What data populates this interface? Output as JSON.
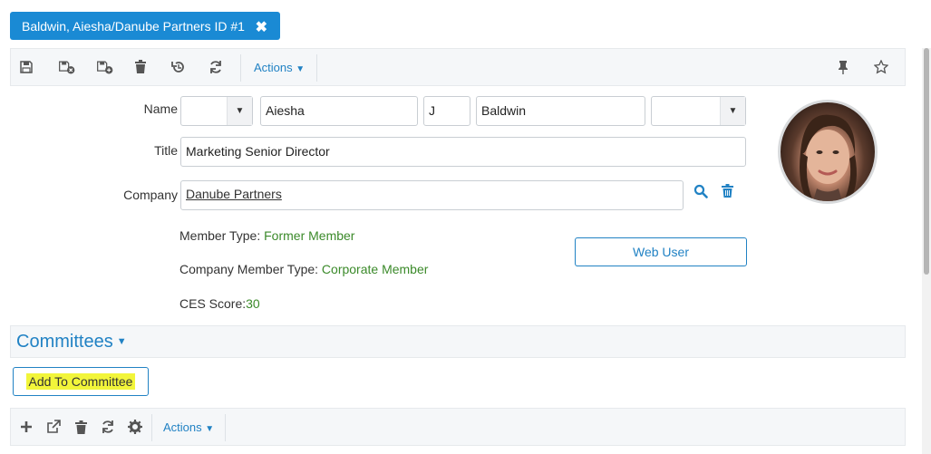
{
  "tab": {
    "title": "Baldwin, Aiesha/Danube Partners ID #1",
    "close_glyph": "✖"
  },
  "toolbar": {
    "icons": [
      "save-icon",
      "save-close-icon",
      "save-new-icon",
      "delete-icon",
      "undo-icon",
      "refresh-icon"
    ],
    "actions_label": "Actions",
    "right_icons": [
      "pin-icon",
      "star-icon"
    ]
  },
  "form": {
    "name_label": "Name",
    "prefix": "",
    "first_name": "Aiesha",
    "middle_initial": "J",
    "last_name": "Baldwin",
    "suffix": "",
    "title_label": "Title",
    "title_value": "Marketing Senior Director",
    "company_label": "Company",
    "company_value": "Danube Partners"
  },
  "info": {
    "member_type_label": "Member Type: ",
    "member_type_value": "Former Member",
    "company_member_type_label": "Company Member Type: ",
    "company_member_type_value": "Corporate Member",
    "ces_label": "CES Score:",
    "ces_value": "30"
  },
  "web_user_button": "Web User",
  "committees": {
    "title": "Committees",
    "add_button": "Add To Committee",
    "actions_label": "Actions"
  },
  "colors": {
    "accent": "#2182c4",
    "tab_bg": "#1a8ad4",
    "value_green": "#3b8a2a",
    "highlight": "#f2f53a"
  }
}
